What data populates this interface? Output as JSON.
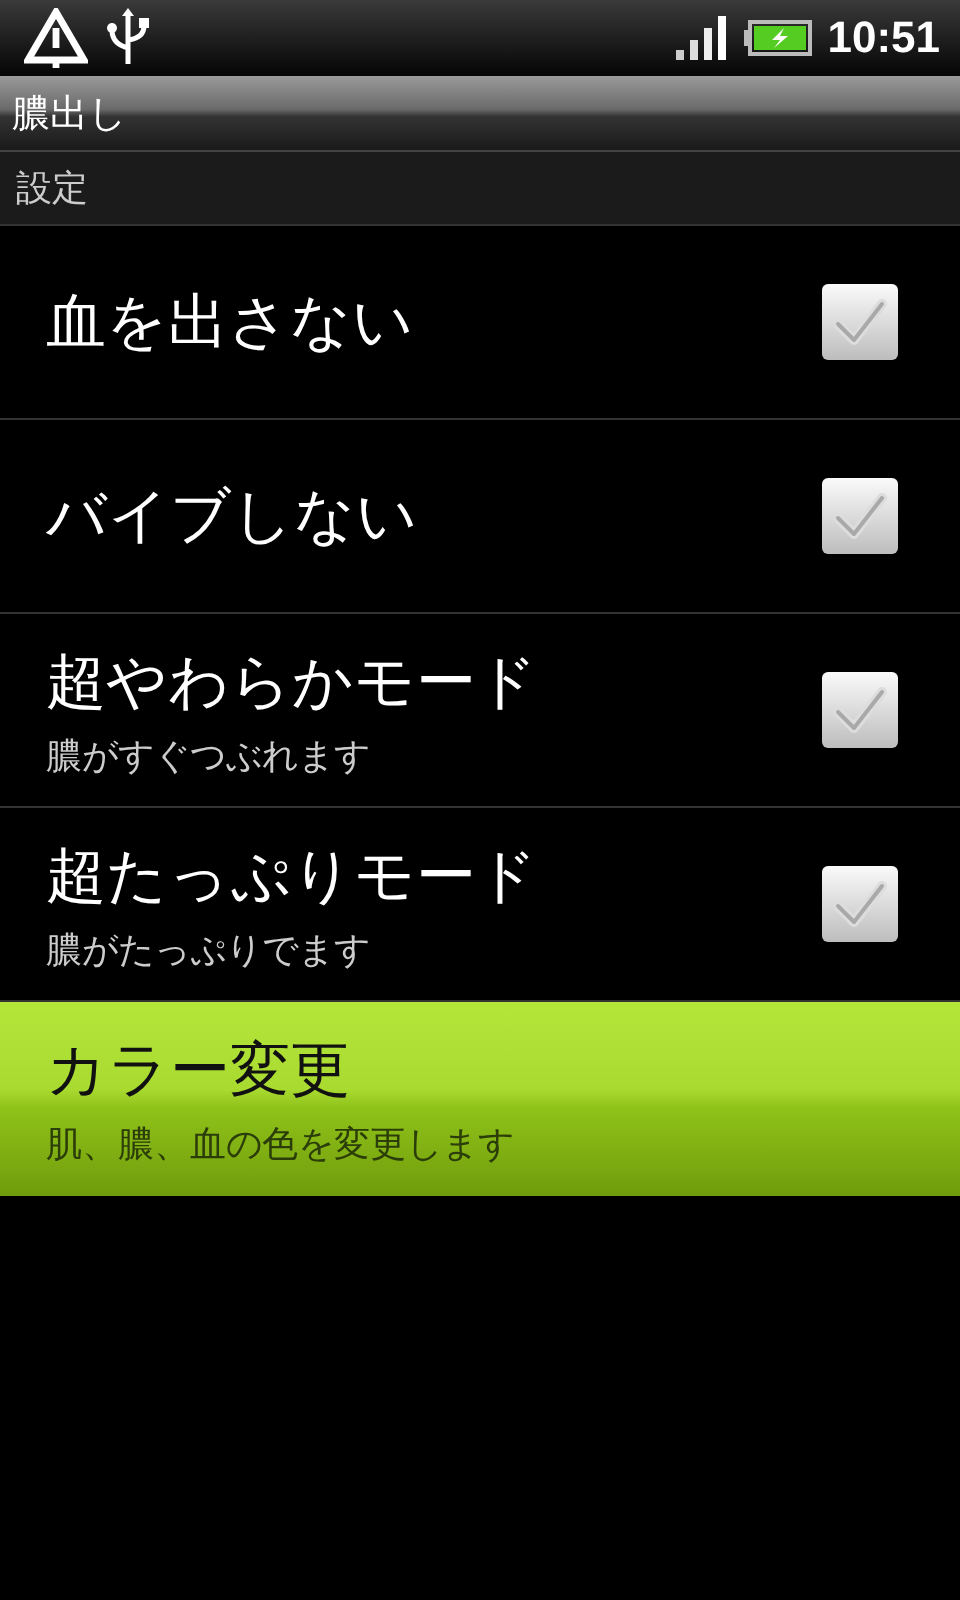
{
  "status_bar": {
    "time": "10:51"
  },
  "title_bar": {
    "title": "膿出し"
  },
  "section": {
    "title": "設定"
  },
  "items": [
    {
      "kind": "checkbox",
      "title": "血を出さない",
      "checked": false,
      "selected": false
    },
    {
      "kind": "checkbox",
      "title": "バイブしない",
      "checked": false,
      "selected": false
    },
    {
      "kind": "checkbox",
      "title": "超やわらかモード",
      "summary": "膿がすぐつぶれます",
      "checked": false,
      "selected": false
    },
    {
      "kind": "checkbox",
      "title": "超たっぷりモード",
      "summary": "膿がたっぷりでます",
      "checked": false,
      "selected": false
    },
    {
      "kind": "plain",
      "title": "カラー変更",
      "summary": "肌、膿、血の色を変更します",
      "selected": true
    }
  ]
}
